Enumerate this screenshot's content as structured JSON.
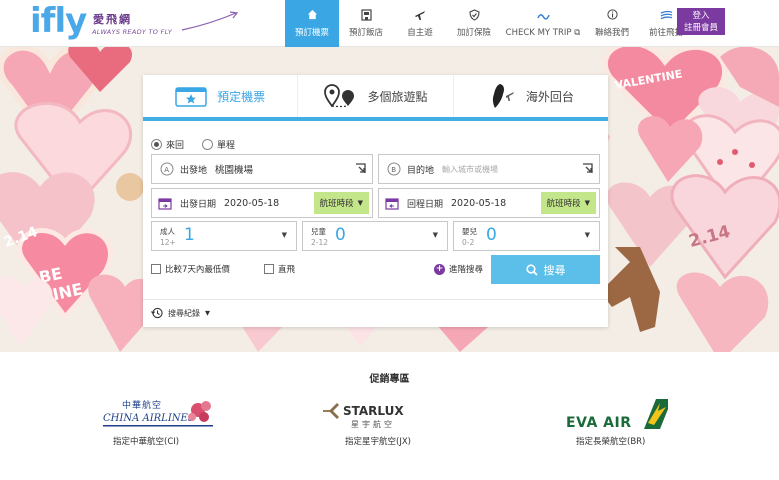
{
  "header": {
    "logo_text": "ifly",
    "logo_cn": "愛飛網",
    "slogan": "ALWAYS READY TO FLY",
    "nav": [
      {
        "label": "預訂機票",
        "icon": "home-icon",
        "active": true
      },
      {
        "label": "預訂飯店",
        "icon": "hotel-icon",
        "active": false
      },
      {
        "label": "自主遊",
        "icon": "plane-icon",
        "active": false
      },
      {
        "label": "加訂保險",
        "icon": "shield-icon",
        "active": false
      },
      {
        "label": "CHECK MY TRIP",
        "icon": "trip-icon",
        "active": false
      },
      {
        "label": "聯絡我們",
        "icon": "info-icon",
        "active": false
      },
      {
        "label": "前往飛揚",
        "icon": "wave-icon",
        "active": false
      }
    ],
    "login_line1": "登入",
    "login_line2": "註冊會員"
  },
  "search": {
    "tabs": [
      {
        "label": "預定機票",
        "icon": "ticket-icon",
        "active": true
      },
      {
        "label": "多個旅遊點",
        "icon": "multi-pin-icon",
        "active": false
      },
      {
        "label": "海外回台",
        "icon": "taiwan-icon",
        "active": false
      }
    ],
    "trip_types": [
      "來回",
      "單程"
    ],
    "selected_trip_type": "來回",
    "origin_label": "出發地",
    "origin_value": "桃園機場",
    "dest_label": "目的地",
    "dest_placeholder": "輸入城市或機場",
    "depart_label": "出發日期",
    "depart_value": "2020-05-18",
    "return_label": "回程日期",
    "return_value": "2020-05-18",
    "time_label": "航班時段",
    "adult_label": "成人",
    "adult_sub": "12+",
    "adult_value": "1",
    "child_label": "兒童",
    "child_sub": "2-12",
    "child_value": "0",
    "infant_label": "嬰兒",
    "infant_sub": "0-2",
    "infant_value": "0",
    "compare_label": "比較7天內最低價",
    "direct_label": "直飛",
    "advanced_label": "進階搜尋",
    "search_label": "搜尋",
    "history_label": "搜尋紀錄"
  },
  "promo": {
    "title": "促銷專區",
    "airlines": [
      {
        "name_cn": "中華航空",
        "name_en": "CHINA AIRLINES",
        "caption": "指定中華航空(CI)"
      },
      {
        "name_en": "STARLUX",
        "name_cn": "星宇航空",
        "caption": "指定星宇航空(JX)"
      },
      {
        "name_en": "EVA AIR",
        "caption": "指定長榮航空(BR)"
      }
    ]
  },
  "colors": {
    "accent": "#3aa6e4",
    "brand_purple": "#7b3aa0",
    "time_button": "#c4e68a",
    "search_button": "#5cbfe9"
  }
}
